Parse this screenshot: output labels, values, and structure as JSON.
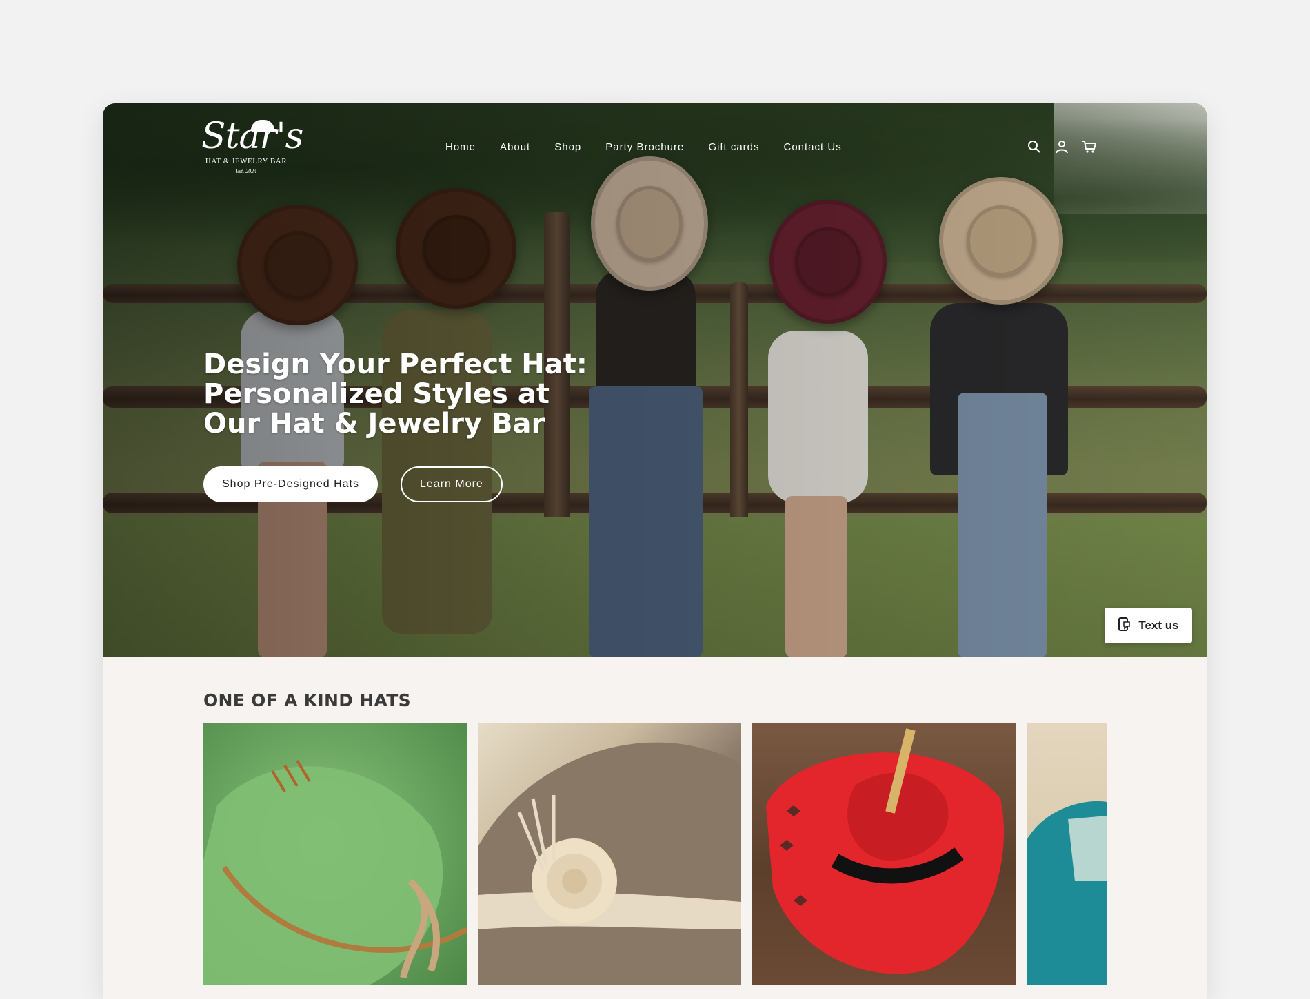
{
  "brand": {
    "logo_script": "Star's",
    "logo_sub": "HAT & JEWELRY BAR",
    "logo_est": "Est. 2024"
  },
  "nav": {
    "items": [
      "Home",
      "About",
      "Shop",
      "Party Brochure",
      "Gift cards",
      "Contact Us"
    ]
  },
  "header_icons": [
    "search-icon",
    "account-icon",
    "cart-icon"
  ],
  "hero": {
    "headline": "Design Your Perfect Hat: Personalized Styles at Our Hat & Jewelry Bar",
    "primary_button": "Shop Pre-Designed Hats",
    "secondary_button": "Learn More"
  },
  "chat_widget": {
    "label": "Text us"
  },
  "collection": {
    "title": "ONE OF A KIND HATS",
    "cards": [
      {
        "name": "green-hat-card"
      },
      {
        "name": "taupe-hat-card"
      },
      {
        "name": "red-hat-card"
      },
      {
        "name": "teal-hat-card"
      }
    ]
  },
  "colors": {
    "page_bg": "#f2f2f2",
    "content_bg": "#f7f3f1",
    "white": "#ffffff",
    "text_dark": "#3a3a3a"
  }
}
